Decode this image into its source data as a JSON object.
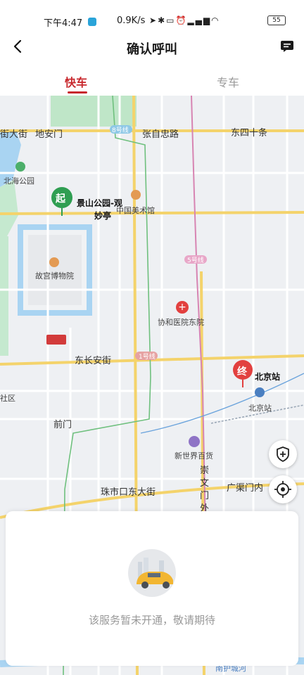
{
  "status_bar": {
    "time": "下午4:47",
    "network_speed": "0.9K/s",
    "battery": "55"
  },
  "header": {
    "title": "确认呼叫",
    "back_icon": "chevron-left-icon",
    "message_icon": "message-icon"
  },
  "tabs": [
    {
      "label": "快车",
      "active": true
    },
    {
      "label": "专车",
      "active": false
    }
  ],
  "map": {
    "labels": {
      "dajie_left": "街大街",
      "dianmen": "地安门",
      "zhangzizhong": "张自忠路",
      "dongsishi": "东四十条",
      "beihai": "北海公园",
      "jingshan_line1": "景山公园-观",
      "jingshan_line2": "妙亭",
      "meishuguan": "中国美术馆",
      "gugong": "故宫博物院",
      "xiehe": "协和医院东院",
      "dongchangan": "东长安街",
      "shequ": "社区",
      "qianmen": "前门",
      "beijingzhan": "北京站",
      "beijingzhan_station": "北京站",
      "xinshijie": "新世界百货",
      "chongwenmen_1": "崇",
      "chongwenmen_2": "文",
      "chongwenmen_3": "门",
      "chongwenmen_4": "外",
      "zhushikou": "珠市口东大街",
      "guangqumen": "广渠门内",
      "nanhucheng": "南护城河",
      "line8": "8号线",
      "line5": "5号线",
      "line1": "1号线"
    },
    "start_marker": "起",
    "end_marker": "终",
    "shield_icon": "shield-plus-icon",
    "locate_icon": "locate-icon"
  },
  "panel": {
    "notice": "该服务暂未开通，敬请期待"
  },
  "colors": {
    "accent": "#c8282d",
    "start_green": "#2f9e52",
    "end_red": "#e2403f"
  }
}
